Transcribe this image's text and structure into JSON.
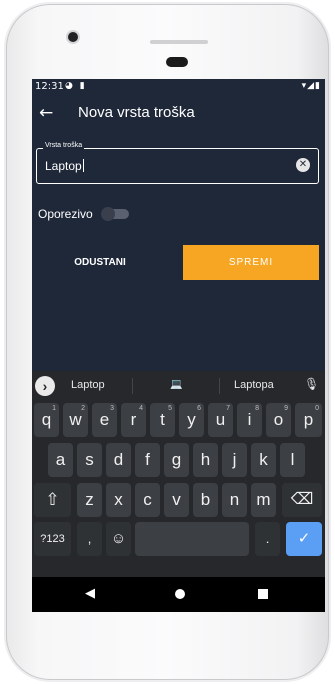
{
  "status_bar": {
    "time": "12:31",
    "left_icons": "◕ ▮",
    "right_icons": "▾◢▮"
  },
  "app_bar": {
    "back_icon": "←",
    "title": "Nova vrsta troška"
  },
  "field": {
    "label": "Vrsta troška",
    "value": "Laptop",
    "clear_icon": "✕"
  },
  "toggle": {
    "label": "Oporezivo",
    "checked": false
  },
  "buttons": {
    "cancel": "ODUSTANI",
    "save": "SPREMI"
  },
  "colors": {
    "background": "#1f2839",
    "accent": "#f6a623",
    "enter_key": "#5b9ff5",
    "keyboard": "#26282b"
  },
  "keyboard": {
    "suggestion_arrow": "›",
    "suggestions": [
      "Laptop",
      "💻",
      "Laptopa"
    ],
    "mic_icon": "🎙",
    "row1": [
      {
        "k": "q",
        "h": "1"
      },
      {
        "k": "w",
        "h": "2"
      },
      {
        "k": "e",
        "h": "3"
      },
      {
        "k": "r",
        "h": "4"
      },
      {
        "k": "t",
        "h": "5"
      },
      {
        "k": "y",
        "h": "6"
      },
      {
        "k": "u",
        "h": "7"
      },
      {
        "k": "i",
        "h": "8"
      },
      {
        "k": "o",
        "h": "9"
      },
      {
        "k": "p",
        "h": "0"
      }
    ],
    "row2": [
      "a",
      "s",
      "d",
      "f",
      "g",
      "h",
      "j",
      "k",
      "l"
    ],
    "row3": [
      "z",
      "x",
      "c",
      "v",
      "b",
      "n",
      "m"
    ],
    "shift_icon": "⇧",
    "backspace_icon": "⌫",
    "symbols_label": "?123",
    "comma": ",",
    "emoji_icon": "☺",
    "period": ".",
    "enter_icon": "✓"
  },
  "nav_bar": {
    "back_icon": "◀"
  }
}
